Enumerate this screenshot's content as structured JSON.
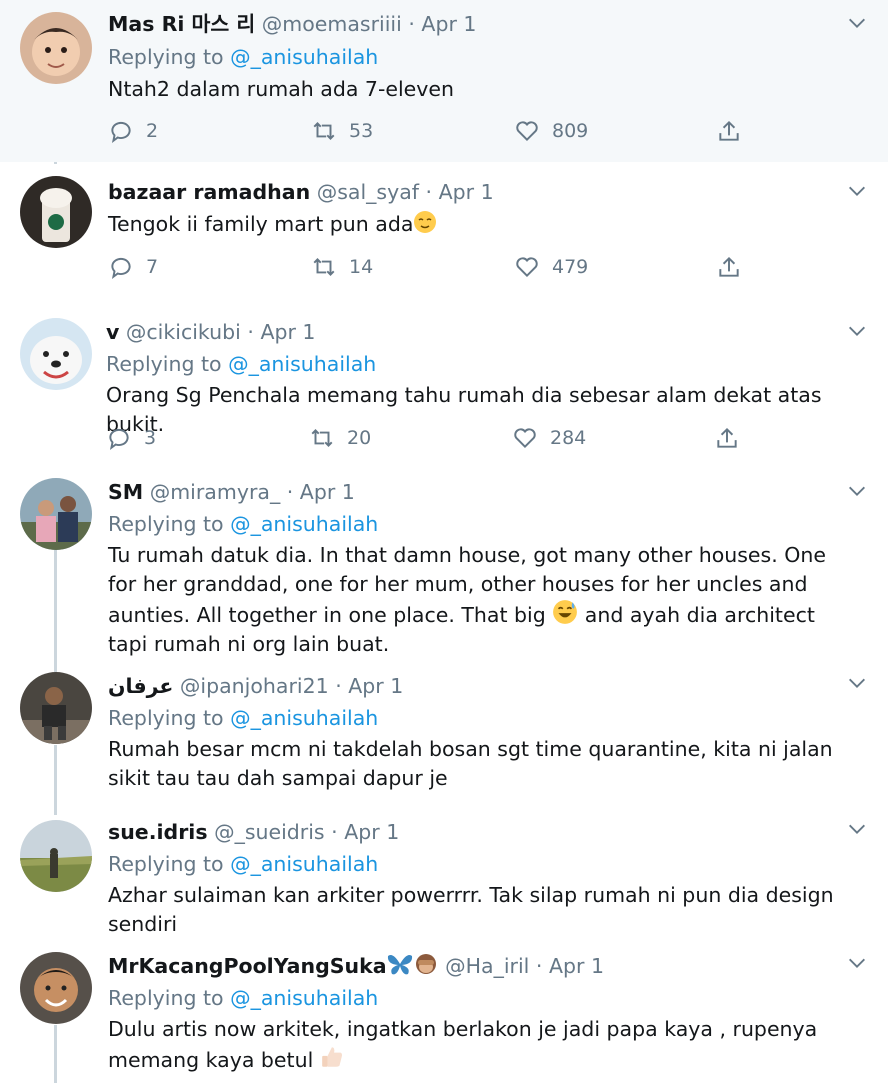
{
  "tweets": [
    {
      "name": "Mas Ri 마스 리",
      "handle": "@moemasriiii",
      "sep": "·",
      "date": "Apr 1",
      "replying": "Replying to",
      "mention": "@_anisuhailah",
      "text": "Ntah2 dalam rumah ada 7-eleven",
      "replies": "2",
      "retweets": "53",
      "likes": "809"
    },
    {
      "name": "bazaar ramadhan",
      "handle": "@sal_syaf",
      "sep": "·",
      "date": "Apr 1",
      "text": "Tengok ii family mart pun ada",
      "replies": "7",
      "retweets": "14",
      "likes": "479"
    },
    {
      "name": "v",
      "handle": "@cikicikubi",
      "sep": "·",
      "date": "Apr 1",
      "replying": "Replying to",
      "mention": "@_anisuhailah",
      "text": "Orang Sg Penchala memang tahu rumah dia sebesar alam dekat atas bukit.",
      "replies": "3",
      "retweets": "20",
      "likes": "284"
    },
    {
      "name": "SM",
      "handle": "@miramyra_",
      "sep": "·",
      "date": "Apr 1",
      "replying": "Replying to",
      "mention": "@_anisuhailah",
      "text_a": "Tu rumah datuk dia. In that damn house, got many other houses. One for her granddad, one for her mum, other houses for her uncles and aunties. All together in one place. That big ",
      "text_b": " and ayah dia architect tapi rumah ni org lain buat."
    },
    {
      "name": "عرفان",
      "handle": "@ipanjohari21",
      "sep": "·",
      "date": "Apr 1",
      "replying": "Replying to",
      "mention": "@_anisuhailah",
      "text": "Rumah besar mcm ni takdelah bosan sgt time quarantine, kita ni jalan sikit tau tau dah sampai dapur je"
    },
    {
      "name": "sue.idris",
      "handle": "@_sueidris",
      "sep": "·",
      "date": "Apr 1",
      "replying": "Replying to",
      "mention": "@_anisuhailah",
      "text": "Azhar sulaiman kan arkiter powerrrr. Tak silap rumah ni pun dia design sendiri"
    },
    {
      "name": "MrKacangPoolYangSuka",
      "handle": "@Ha_iril",
      "sep": "·",
      "date": "Apr 1",
      "replying": "Replying to",
      "mention": "@_anisuhailah",
      "text": "Dulu artis now arkitek, ingatkan berlakon je jadi papa kaya , rupenya memang kaya betul "
    }
  ],
  "colors": {
    "highlight_bg": "#f5f8fa",
    "mention": "#1b95e0",
    "muted": "#657786",
    "thread_line": "#ccd6dd"
  },
  "icons": [
    "reply-icon",
    "retweet-icon",
    "like-icon",
    "share-icon",
    "chevron-down-icon"
  ]
}
